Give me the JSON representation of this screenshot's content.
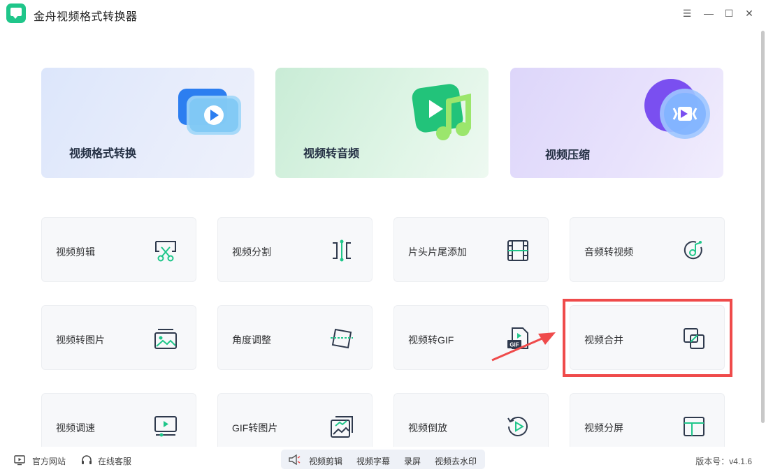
{
  "app": {
    "title": "金舟视频格式转换器"
  },
  "window_controls": [
    {
      "name": "menu-button",
      "glyph": "☰"
    },
    {
      "name": "minimize-button",
      "glyph": "—"
    },
    {
      "name": "maximize-button",
      "glyph": "☐"
    },
    {
      "name": "close-button",
      "glyph": "✕"
    }
  ],
  "main_cards": [
    {
      "label": "视频格式转换",
      "icon": "video-play-icon"
    },
    {
      "label": "视频转音频",
      "icon": "music-note-icon"
    },
    {
      "label": "视频压缩",
      "icon": "compress-icon"
    }
  ],
  "tools": [
    {
      "label": "视频剪辑",
      "icon": "scissors-icon"
    },
    {
      "label": "视频分割",
      "icon": "split-icon"
    },
    {
      "label": "片头片尾添加",
      "icon": "film-icon"
    },
    {
      "label": "音频转视频",
      "icon": "audio-disc-icon"
    },
    {
      "label": "视频转图片",
      "icon": "image-icon"
    },
    {
      "label": "角度调整",
      "icon": "rotate-angle-icon"
    },
    {
      "label": "视频转GIF",
      "icon": "gif-file-icon"
    },
    {
      "label": "视频合并",
      "icon": "merge-icon"
    },
    {
      "label": "视频调速",
      "icon": "speed-monitor-icon"
    },
    {
      "label": "GIF转图片",
      "icon": "gif-image-icon"
    },
    {
      "label": "视频倒放",
      "icon": "reverse-play-icon"
    },
    {
      "label": "视频分屏",
      "icon": "split-screen-icon"
    }
  ],
  "footer": {
    "website": "官方网站",
    "support": "在线客服",
    "quick_tools": [
      "视频剪辑",
      "视频字幕",
      "录屏",
      "视频去水印"
    ],
    "version": "版本号：v4.1.6"
  },
  "colors": {
    "accent_green": "#1fc68a",
    "icon_dark": "#2f3a4d",
    "highlight_red": "#ef4b4b"
  }
}
